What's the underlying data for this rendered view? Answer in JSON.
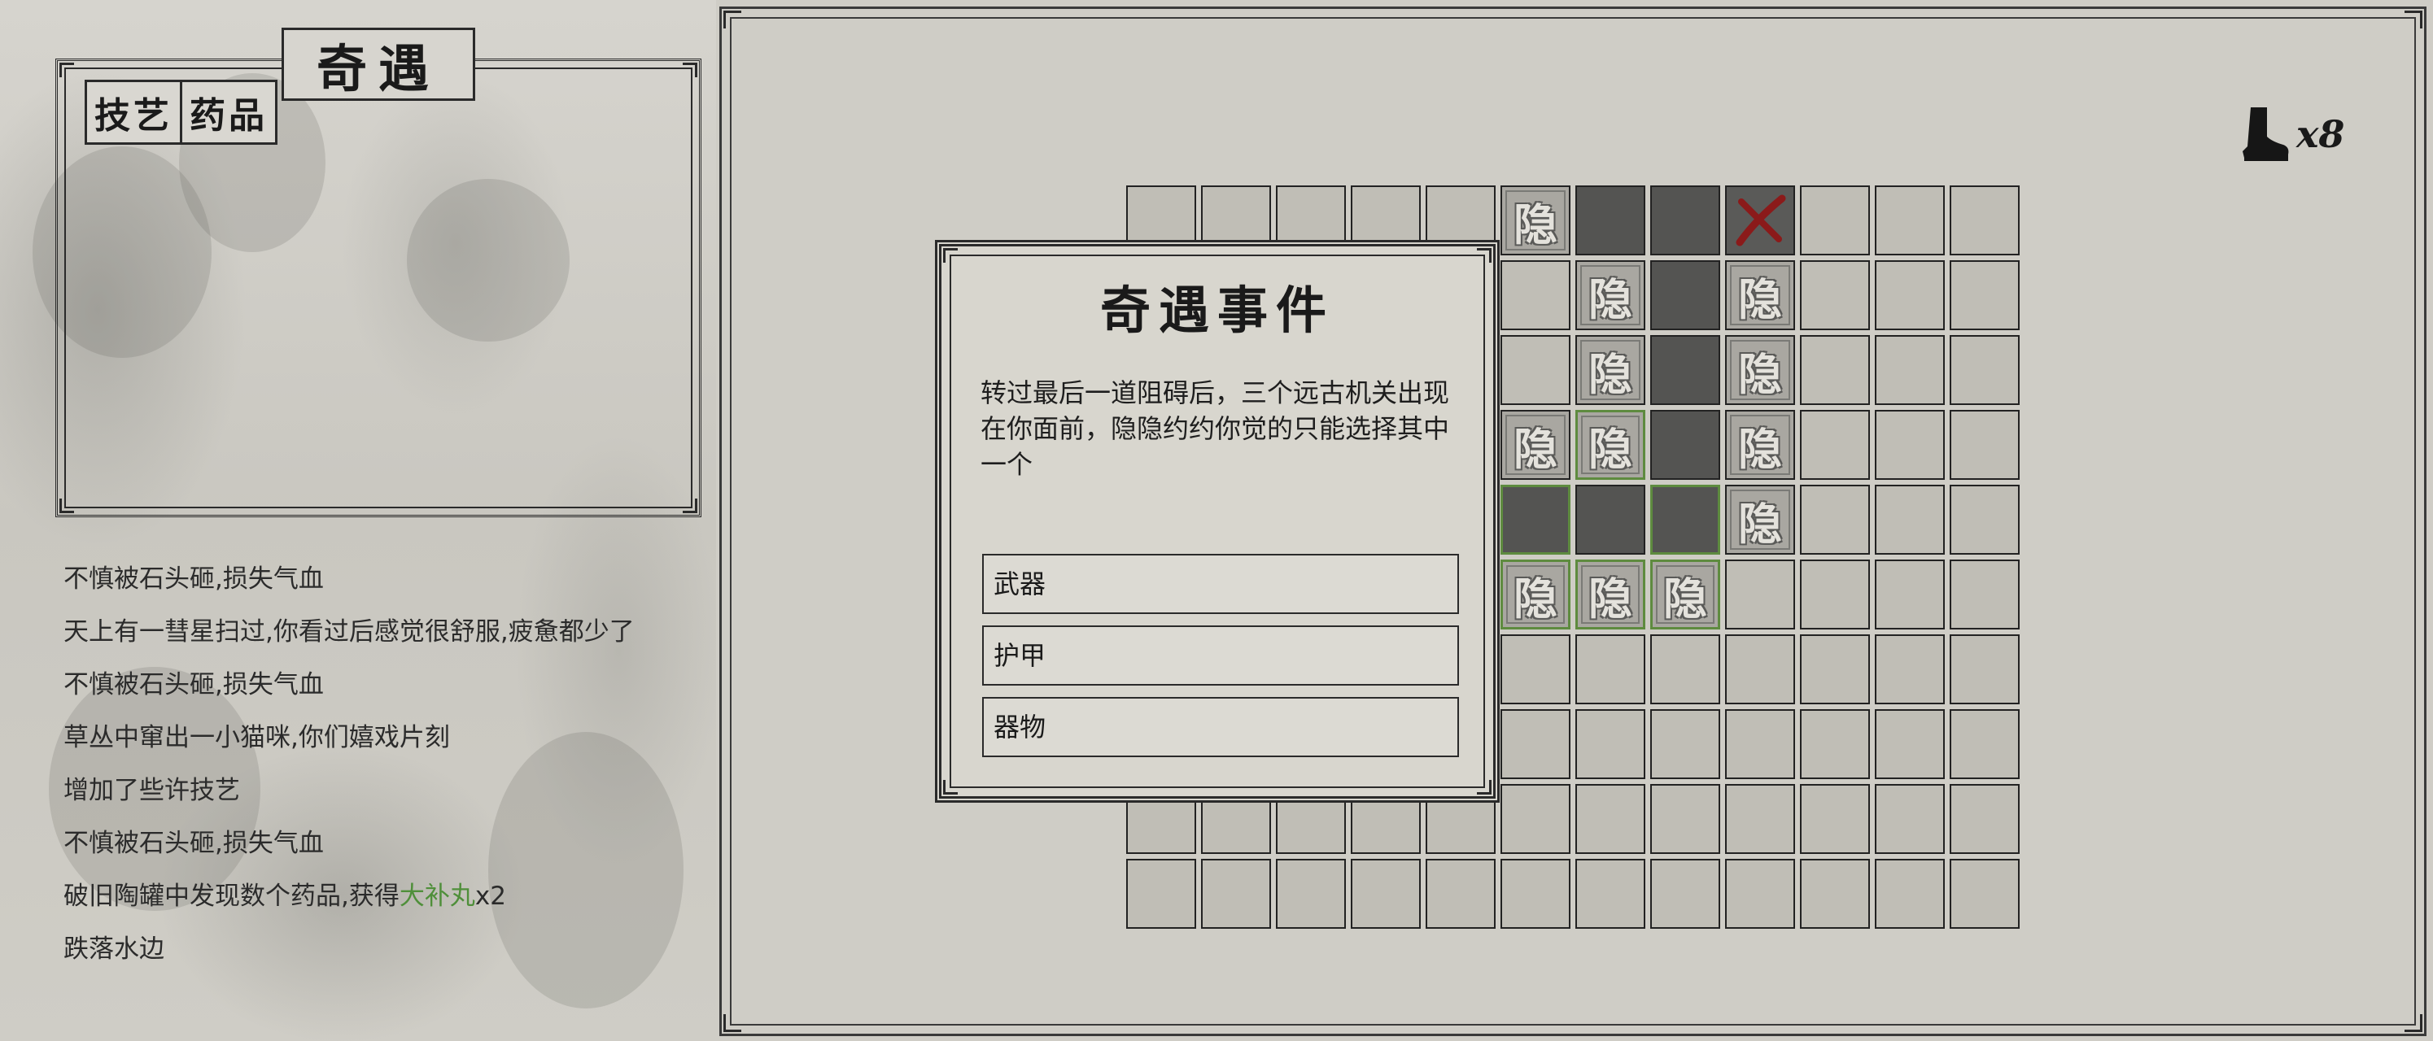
{
  "left_panel": {
    "title": "奇遇",
    "tabs": [
      {
        "label": "技艺"
      },
      {
        "label": "药品"
      }
    ]
  },
  "log": [
    {
      "text": "不慎被石头砸,损失气血"
    },
    {
      "text": "天上有一彗星扫过,你看过后感觉很舒服,疲惫都少了"
    },
    {
      "text": "不慎被石头砸,损失气血"
    },
    {
      "text": "草丛中窜出一小猫咪,你们嬉戏片刻"
    },
    {
      "text": "增加了些许技艺"
    },
    {
      "text": "不慎被石头砸,损失气血"
    },
    {
      "text_before": "破旧陶罐中发现数个药品,获得",
      "highlight": "大补丸",
      "text_after": "x2"
    },
    {
      "text": "跌落水边"
    }
  ],
  "colors": {
    "highlight": "#4f8f3a",
    "exit_mark": "#8b1a1a",
    "explored_border": "#5e8b3f"
  },
  "steps": {
    "icon": "boot-icon",
    "count": "x8"
  },
  "board": {
    "rows": 10,
    "cols": 12,
    "hidden_label": "隐",
    "cells": [
      [
        "e",
        "e",
        "e",
        "e",
        "e",
        "h",
        "d",
        "d",
        "x",
        "e",
        "e",
        "e"
      ],
      [
        "e",
        "e",
        "e",
        "e",
        "e",
        "e",
        "h",
        "d",
        "h",
        "e",
        "e",
        "e"
      ],
      [
        "e",
        "e",
        "e",
        "e",
        "e",
        "e",
        "h",
        "d",
        "h",
        "e",
        "e",
        "e"
      ],
      [
        "e",
        "e",
        "e",
        "e",
        "e",
        "h",
        "hg",
        "d",
        "h",
        "e",
        "e",
        "e"
      ],
      [
        "e",
        "e",
        "e",
        "e",
        "e",
        "dg",
        "d",
        "dg",
        "h",
        "e",
        "e",
        "e"
      ],
      [
        "e",
        "e",
        "e",
        "e",
        "e",
        "hg",
        "hg",
        "hg",
        "e",
        "e",
        "e",
        "e"
      ],
      [
        "e",
        "e",
        "e",
        "e",
        "e",
        "e",
        "e",
        "e",
        "e",
        "e",
        "e",
        "e"
      ],
      [
        "e",
        "e",
        "e",
        "e",
        "e",
        "e",
        "e",
        "e",
        "e",
        "e",
        "e",
        "e"
      ],
      [
        "e",
        "e",
        "e",
        "e",
        "e",
        "e",
        "e",
        "e",
        "e",
        "e",
        "e",
        "e"
      ],
      [
        "e",
        "e",
        "e",
        "e",
        "e",
        "e",
        "e",
        "e",
        "e",
        "e",
        "e",
        "e"
      ]
    ]
  },
  "dialog": {
    "title": "奇遇事件",
    "text": "转过最后一道阻碍后，三个远古机关出现在你面前，隐隐约约你觉的只能选择其中一个",
    "options": [
      {
        "label": "武器"
      },
      {
        "label": "护甲"
      },
      {
        "label": "器物"
      }
    ]
  }
}
